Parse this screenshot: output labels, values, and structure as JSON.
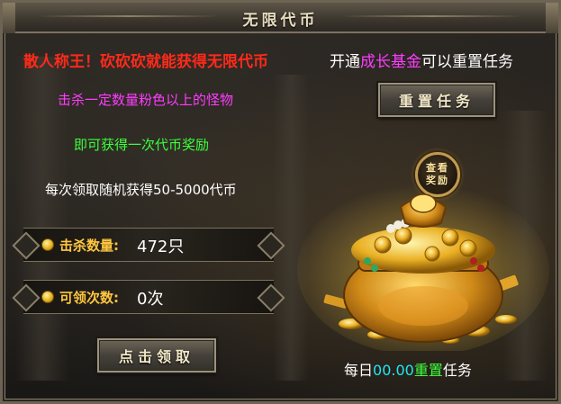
{
  "title": "无限代币",
  "headline_left": "散人称王！砍砍砍就能获得无限代币",
  "headline_right": {
    "prefix": "开通",
    "highlight": "成长基金",
    "suffix": "可以重置任务"
  },
  "kill_info": "击杀一定数量粉色以上的怪物",
  "reward_info": "即可获得一次代币奖励",
  "random_info": "每次领取随机获得50-5000代币",
  "reset_button_label": "重置任务",
  "view_reward": {
    "line1": "查看",
    "line2": "奖励"
  },
  "kill_stat": {
    "label": "击杀数量:",
    "value": "472只"
  },
  "claimable_stat": {
    "label": "可领次数:",
    "value": "0次"
  },
  "claim_button_label": "点击领取",
  "daily_reset": {
    "prefix": "每日",
    "time": "00.00",
    "highlight": "重置",
    "suffix": "任务"
  },
  "colors": {
    "headline_red": "#ff2a1a",
    "pink": "#ff3cff",
    "green": "#3cff3c",
    "gold": "#ffc640",
    "cyan": "#20e8f0"
  },
  "icons": {
    "coin": "gold-coin-icon",
    "treasure": "treasure-pot-icon"
  }
}
